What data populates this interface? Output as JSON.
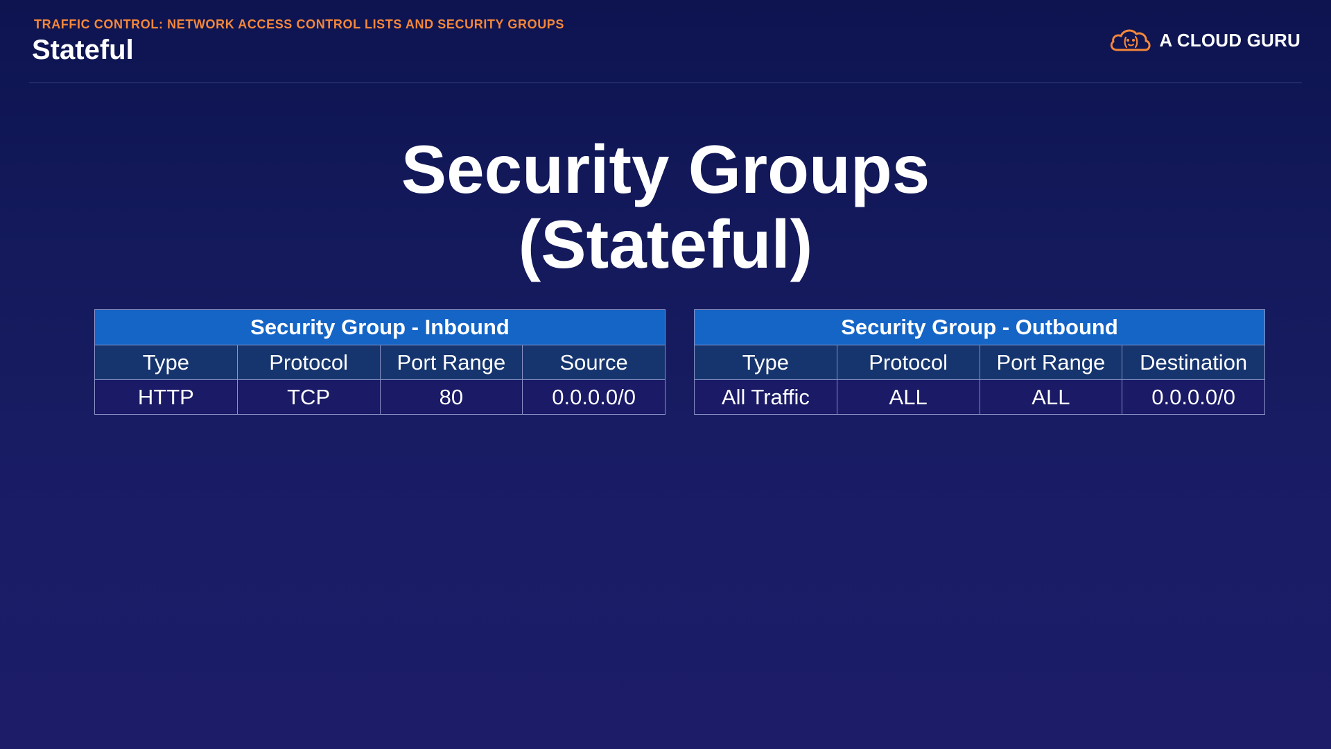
{
  "header": {
    "breadcrumb": "TRAFFIC CONTROL: NETWORK ACCESS CONTROL LISTS AND SECURITY GROUPS",
    "page_title": "Stateful",
    "brand_name": "A CLOUD GURU",
    "brand_icon": "cloud-logo-icon",
    "colors": {
      "accent": "#f5873a",
      "background": "#141a5c"
    }
  },
  "slide": {
    "heading_line1": "Security Groups",
    "heading_line2": "(Stateful)"
  },
  "inbound_table": {
    "caption": "Security Group - Inbound",
    "columns": [
      "Type",
      "Protocol",
      "Port Range",
      "Source"
    ],
    "rows": [
      [
        "HTTP",
        "TCP",
        "80",
        "0.0.0.0/0"
      ]
    ],
    "caption_color": "#1565c7",
    "header_color": "#16356e"
  },
  "outbound_table": {
    "caption": "Security Group - Outbound",
    "columns": [
      "Type",
      "Protocol",
      "Port Range",
      "Destination"
    ],
    "rows": [
      [
        "All Traffic",
        "ALL",
        "ALL",
        "0.0.0.0/0"
      ]
    ],
    "caption_color": "#1565c7",
    "header_color": "#16356e"
  }
}
